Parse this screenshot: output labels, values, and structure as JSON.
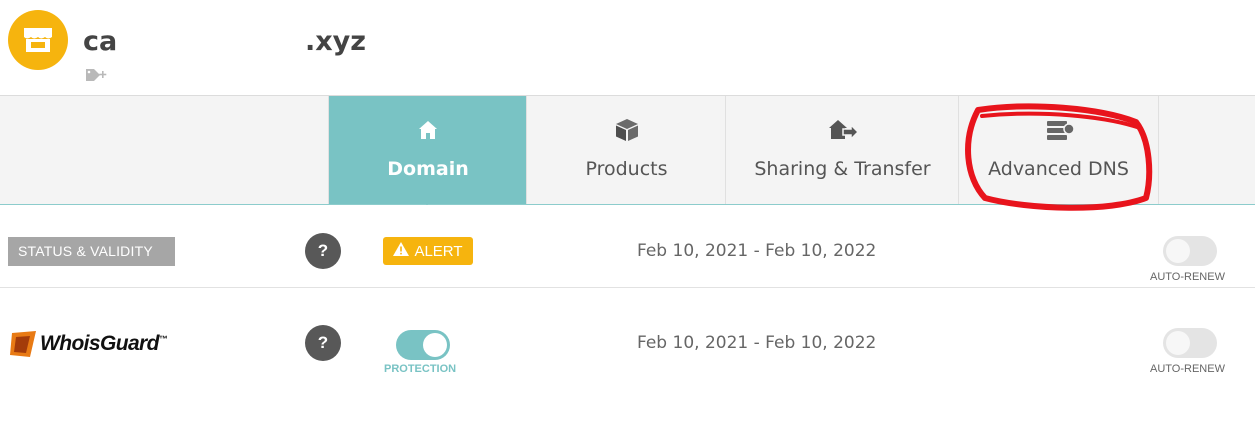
{
  "header": {
    "domain_prefix": "ca",
    "domain_suffix": ".xyz"
  },
  "tabs": [
    {
      "label": "Domain",
      "icon": "home-icon",
      "active": true
    },
    {
      "label": "Products",
      "icon": "box-icon",
      "active": false
    },
    {
      "label": "Sharing & Transfer",
      "icon": "house-arrow-icon",
      "active": false
    },
    {
      "label": "Advanced DNS",
      "icon": "server-icon",
      "active": false
    }
  ],
  "rows": {
    "status": {
      "label": "STATUS & VALIDITY",
      "help": "?",
      "badge": "ALERT",
      "dates": "Feb 10, 2021 - Feb 10, 2022",
      "toggle_caption": "AUTO-RENEW",
      "auto_renew_on": false
    },
    "whoisguard": {
      "logo_text": "WhoisGuard",
      "logo_mark": "™",
      "help": "?",
      "protection_caption": "PROTECTION",
      "protection_on": true,
      "dates": "Feb 10, 2021 - Feb 10, 2022",
      "toggle_caption": "AUTO-RENEW",
      "auto_renew_on": false
    }
  },
  "colors": {
    "accent_teal": "#79c3c4",
    "alert_yellow": "#f6b40e",
    "annotation_red": "#e8141c"
  }
}
